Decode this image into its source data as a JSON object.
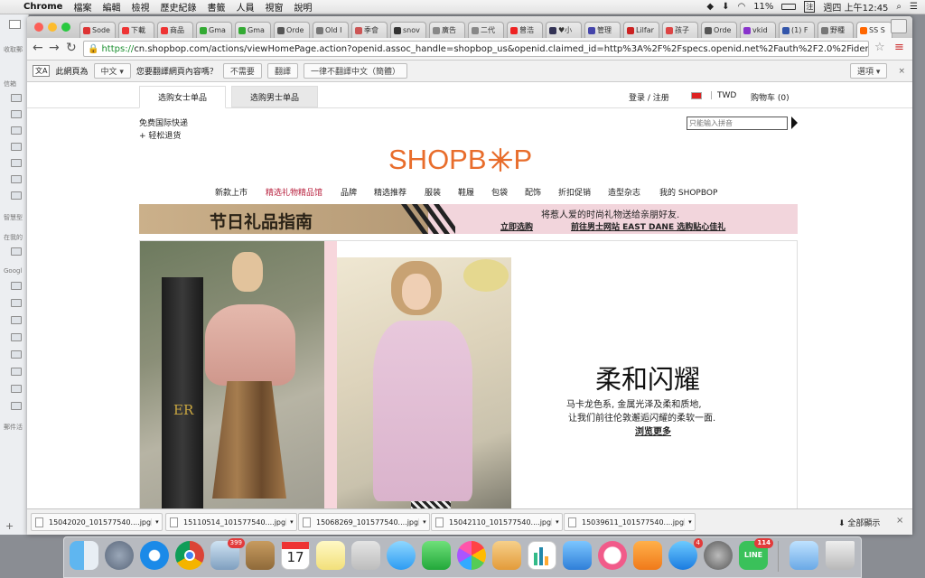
{
  "menubar": {
    "apple": "",
    "app": "Chrome",
    "items": [
      "檔案",
      "編輯",
      "檢視",
      "歷史紀錄",
      "書籤",
      "人員",
      "視窗",
      "說明"
    ],
    "battery": "11%",
    "clock": "週四 上午12:45"
  },
  "background_app": {
    "labels": [
      "收取郵",
      "信箱",
      "智慧型",
      "在我的",
      "Googl",
      "郵件活"
    ]
  },
  "browser": {
    "tabs": [
      {
        "label": "Sode",
        "color": "#d33"
      },
      {
        "label": "下載",
        "color": "#e33"
      },
      {
        "label": "商品",
        "color": "#e33"
      },
      {
        "label": "Gma",
        "color": "#3a3"
      },
      {
        "label": "Gma",
        "color": "#3a3"
      },
      {
        "label": "Orde",
        "color": "#555"
      },
      {
        "label": "Old I",
        "color": "#777"
      },
      {
        "label": "季會",
        "color": "#c55"
      },
      {
        "label": "snov",
        "color": "#333"
      },
      {
        "label": "廣告",
        "color": "#888"
      },
      {
        "label": "二代",
        "color": "#888"
      },
      {
        "label": "曾浩",
        "color": "#e22"
      },
      {
        "label": "♥小",
        "color": "#335"
      },
      {
        "label": "管理",
        "color": "#44a"
      },
      {
        "label": "Lilfar",
        "color": "#c22"
      },
      {
        "label": "孩子",
        "color": "#d44"
      },
      {
        "label": "Orde",
        "color": "#555"
      },
      {
        "label": "vkid",
        "color": "#83c"
      },
      {
        "label": "(1) F",
        "color": "#35a"
      },
      {
        "label": "野種",
        "color": "#777"
      },
      {
        "label": "SS S",
        "color": "#f60"
      }
    ],
    "url_scheme": "https://",
    "url_rest": "cn.shopbop.com/actions/viewHomePage.action?openid.assoc_handle=shopbop_us&openid.claimed_id=http%3A%2F%2Fspecs.openid.net%2Fauth%2F2.0%2Fidentifier_selec...",
    "translate_bar": {
      "prefix": "此網頁為",
      "language": "中文",
      "question": "您要翻譯網頁內容嗎？",
      "no": "不需要",
      "translate": "翻譯",
      "never": "一律不翻譯中文（簡體）",
      "options": "選項",
      "close": "×"
    }
  },
  "site": {
    "tabs": [
      "选购女士单品",
      "选购男士单品"
    ],
    "login": "登录 / 注册",
    "currency": "TWD",
    "cart": "购物车 (0)",
    "shipping_1": "免费国际快递",
    "shipping_2": "+ 轻松退货",
    "search_placeholder": "只能输入拼音",
    "logo_left": "SHOPB",
    "logo_right": "P",
    "nav": [
      "新款上市",
      "精选礼物精品馆",
      "品牌",
      "精选推荐",
      "服装",
      "鞋履",
      "包袋",
      "配饰",
      "折扣促销",
      "造型杂志",
      "我的 SHOPBOP"
    ],
    "banner": {
      "title": "节日礼品指南",
      "line1": "将惹人爱的时尚礼物送给亲朋好友.",
      "link1": "立即选购",
      "link2": "前往男士网站 EAST DANE 选购贴心佳礼"
    },
    "hero": {
      "title": "柔和闪耀",
      "line1": "马卡龙色系, 金属光泽及柔和质地,",
      "line2": "让我们前往伦敦邂逅闪耀的柔软一面.",
      "cta": "浏览更多",
      "monogram": "ER"
    },
    "colors": {
      "accent": "#e86d2c",
      "promo_red": "#b8213e",
      "banner_pink": "#f2d5dc"
    }
  },
  "downloads": {
    "files": [
      "15042020_101577540....jpg",
      "15110514_101577540....jpg",
      "15068269_101577540....jpg",
      "15042110_101577540....jpg",
      "15039611_101577540....jpg"
    ],
    "show_all": "全部顯示",
    "close": "×"
  },
  "dock": {
    "mail_badge": "399",
    "appstore_badge": "4",
    "line_badge": "114",
    "calendar_day": "17",
    "line_label": "LINE"
  }
}
